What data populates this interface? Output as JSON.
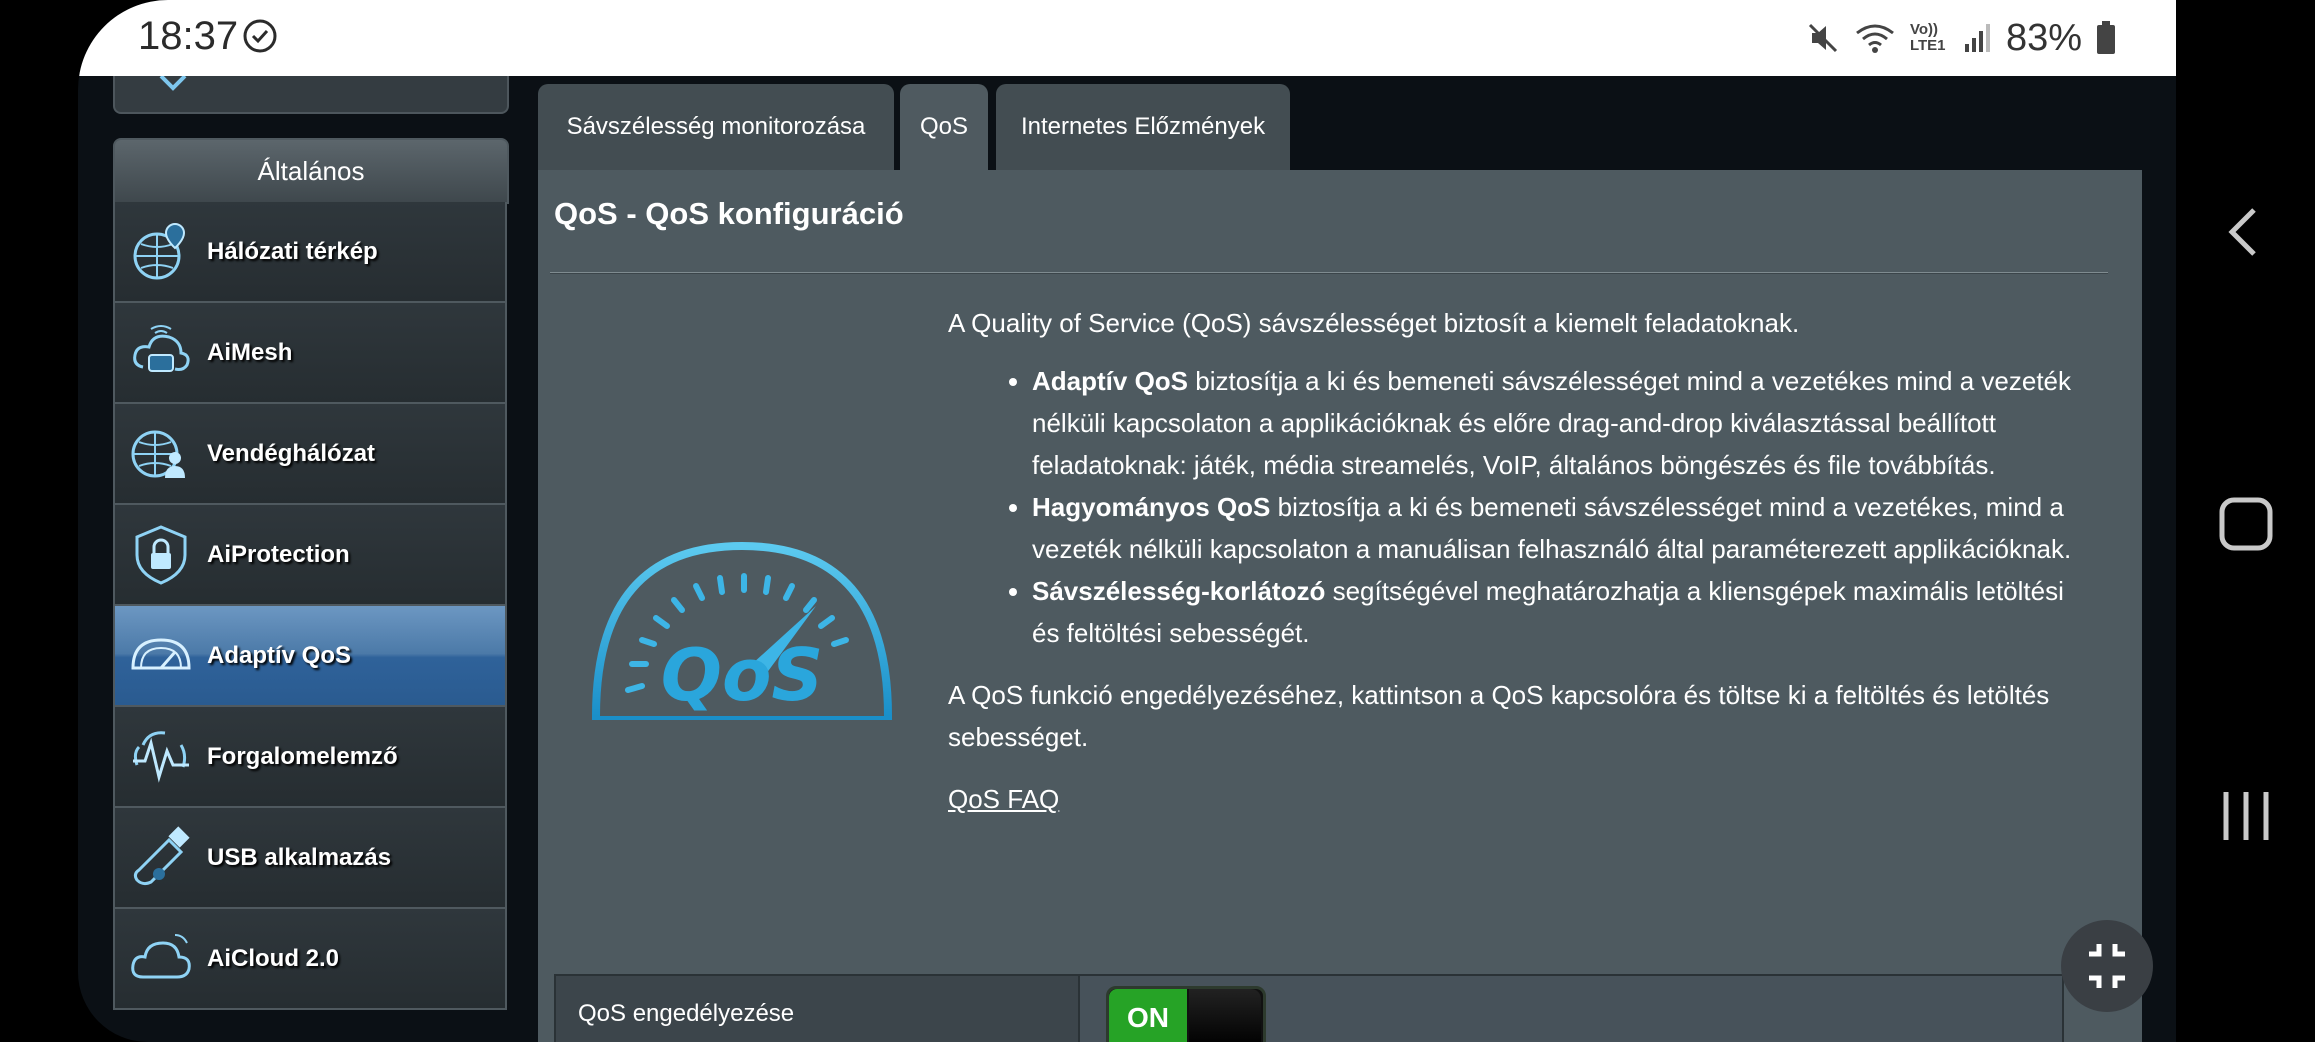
{
  "status_bar": {
    "time": "18:37",
    "battery_percent": "83%",
    "network_label": "Vo)) LTE1"
  },
  "sidebar": {
    "section_title": "Általános",
    "items": [
      {
        "label": "Hálózati térkép",
        "icon": "network-map-icon"
      },
      {
        "label": "AiMesh",
        "icon": "aimesh-icon"
      },
      {
        "label": "Vendéghálózat",
        "icon": "guest-network-icon"
      },
      {
        "label": "AiProtection",
        "icon": "shield-lock-icon"
      },
      {
        "label": "Adaptív QoS",
        "icon": "speedometer-icon"
      },
      {
        "label": "Forgalomelemző",
        "icon": "traffic-analyzer-icon"
      },
      {
        "label": "USB alkalmazás",
        "icon": "usb-icon"
      },
      {
        "label": "AiCloud 2.0",
        "icon": "cloud-icon"
      }
    ]
  },
  "tabs": [
    {
      "label": "Sávszélesség monitorozása"
    },
    {
      "label": "QoS"
    },
    {
      "label": "Internetes Előzmények"
    }
  ],
  "page": {
    "title": "QoS - QoS konfiguráció",
    "intro": "A Quality of Service (QoS) sávszélességet biztosít a kiemelt feladatoknak.",
    "bullets": [
      {
        "bold": "Adaptív QoS",
        "text": " biztosítja a ki és bemeneti sávszélességet mind a vezetékes mind a vezeték nélküli kapcsolaton a applikációknak és előre drag-and-drop kiválasztással beállított feladatoknak: játék, média streamelés, VoIP, általános böngészés és file továbbítás."
      },
      {
        "bold": "Hagyományos QoS",
        "text": " biztosítja a ki és bemeneti sávszélességet mind a vezetékes, mind a vezeték nélküli kapcsolaton a manuálisan felhasználó által paraméterezett applikációknak."
      },
      {
        "bold": "Sávszélesség-korlátozó",
        "text": " segítségével meghatározhatja a kliensgépek maximális letöltési és feltöltési sebességét."
      }
    ],
    "enable_note": "A QoS funkció engedélyezéséhez, kattintson a QoS kapcsolóra és töltse ki a feltöltés és letöltés sebességet.",
    "faq_link": "QoS FAQ",
    "logo_text": "QoS",
    "enable_label": "QoS engedélyezése",
    "toggle_state": "ON"
  },
  "colors": {
    "accent_blue": "#2f629a",
    "toggle_green": "#26a326",
    "panel": "#4e5a60"
  }
}
